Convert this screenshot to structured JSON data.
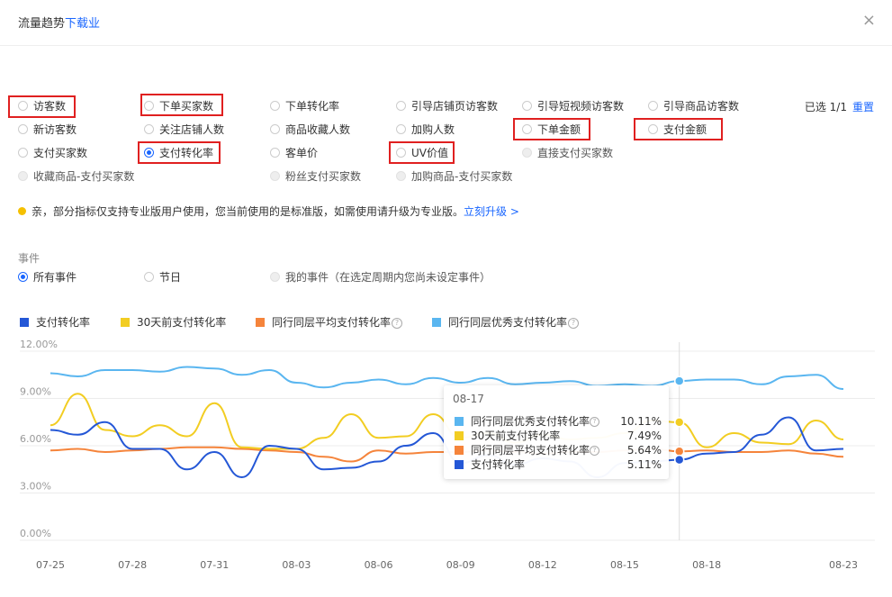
{
  "header": {
    "title": "流量趋势",
    "title_link": "下载业",
    "close_icon": "×"
  },
  "metrics": [
    {
      "label": "访客数",
      "state": "normal"
    },
    {
      "label": "下单买家数",
      "state": "normal"
    },
    {
      "label": "下单转化率",
      "state": "normal"
    },
    {
      "label": "引导店铺页访客数",
      "state": "normal"
    },
    {
      "label": "引导短视频访客数",
      "state": "normal"
    },
    {
      "label": "引导商品访客数",
      "state": "normal"
    },
    {
      "label": "新访客数",
      "state": "normal"
    },
    {
      "label": "关注店铺人数",
      "state": "normal"
    },
    {
      "label": "商品收藏人数",
      "state": "normal"
    },
    {
      "label": "加购人数",
      "state": "normal"
    },
    {
      "label": "下单金额",
      "state": "normal"
    },
    {
      "label": "支付金额",
      "state": "normal"
    },
    {
      "label": "支付买家数",
      "state": "normal"
    },
    {
      "label": "支付转化率",
      "state": "checked"
    },
    {
      "label": "客单价",
      "state": "normal"
    },
    {
      "label": "UV价值",
      "state": "normal"
    },
    {
      "label": "直接支付买家数",
      "state": "disabled"
    },
    {
      "label": "收藏商品-支付买家数",
      "state": "disabled"
    },
    {
      "label": "粉丝支付买家数",
      "state": "disabled"
    },
    {
      "label": "加购商品-支付买家数",
      "state": "disabled"
    }
  ],
  "selection": {
    "info": "已选 1/1",
    "reset": "重置"
  },
  "notice": {
    "text": "亲，部分指标仅支持专业版用户使用，您当前使用的是标准版，如需使用请升级为专业版。",
    "upgrade": "立刻升级 >"
  },
  "events": {
    "label": "事件",
    "options": [
      {
        "label": "所有事件",
        "state": "checked"
      },
      {
        "label": "节日",
        "state": "normal"
      },
      {
        "label": "我的事件（在选定周期内您尚未设定事件）",
        "state": "disabled"
      }
    ]
  },
  "help_icon": "?",
  "chart_data": {
    "type": "line",
    "colors": {
      "支付转化率": "#2457d6",
      "30天前支付转化率": "#f2cd22",
      "同行同层平均支付转化率": "#f5843b",
      "同行同层优秀支付转化率": "#5ab6f0"
    },
    "x": [
      "07-25",
      "07-26",
      "07-27",
      "07-28",
      "07-29",
      "07-30",
      "07-31",
      "08-01",
      "08-02",
      "08-03",
      "08-04",
      "08-05",
      "08-06",
      "08-07",
      "08-08",
      "08-09",
      "08-10",
      "08-11",
      "08-12",
      "08-13",
      "08-14",
      "08-15",
      "08-16",
      "08-17",
      "08-18",
      "08-19",
      "08-20",
      "08-21",
      "08-22",
      "08-23"
    ],
    "xticks": [
      "07-25",
      "07-28",
      "07-31",
      "08-03",
      "08-06",
      "08-09",
      "08-12",
      "08-15",
      "08-18",
      "08-23"
    ],
    "yticks": [
      "0.00%",
      "3.00%",
      "6.00%",
      "9.00%",
      "12.00%"
    ],
    "ylim": [
      0,
      12
    ],
    "series": [
      {
        "name": "支付转化率",
        "values": [
          7.0,
          6.7,
          7.5,
          5.8,
          5.8,
          4.5,
          5.6,
          4.0,
          6.0,
          5.8,
          4.5,
          4.6,
          5.0,
          6.0,
          6.8,
          4.9,
          5.4,
          4.8,
          5.2,
          5.0,
          4.0,
          4.9,
          5.0,
          5.11,
          5.5,
          5.6,
          6.7,
          7.8,
          5.7,
          5.8
        ]
      },
      {
        "name": "30天前支付转化率",
        "values": [
          7.3,
          9.3,
          7.0,
          6.6,
          7.3,
          6.6,
          8.7,
          5.9,
          5.8,
          5.8,
          6.5,
          8.0,
          6.5,
          6.6,
          8.0,
          6.5,
          6.8,
          6.2,
          6.7,
          6.4,
          6.5,
          6.8,
          7.6,
          7.49,
          5.9,
          6.8,
          6.2,
          6.1,
          7.6,
          6.4
        ]
      },
      {
        "name": "同行同层平均支付转化率",
        "values": [
          5.7,
          5.8,
          5.6,
          5.7,
          5.8,
          5.9,
          5.9,
          5.8,
          5.7,
          5.6,
          5.3,
          5.0,
          5.7,
          5.5,
          5.6,
          5.6,
          5.7,
          5.6,
          5.5,
          5.6,
          5.6,
          5.7,
          5.8,
          5.64,
          5.7,
          5.6,
          5.6,
          5.7,
          5.5,
          5.3
        ]
      },
      {
        "name": "同行同层优秀支付转化率",
        "values": [
          10.6,
          10.4,
          10.8,
          10.8,
          10.7,
          11.0,
          10.9,
          10.5,
          10.8,
          10.0,
          9.7,
          10.0,
          10.2,
          9.9,
          10.3,
          10.0,
          10.3,
          9.9,
          10.0,
          10.1,
          9.8,
          9.9,
          9.8,
          10.11,
          10.2,
          10.2,
          9.9,
          10.4,
          10.5,
          9.6
        ]
      }
    ],
    "tooltip": {
      "date": "08-17",
      "rows": [
        {
          "name": "同行同层优秀支付转化率",
          "value": "10.11%",
          "help": true,
          "color": "#5ab6f0"
        },
        {
          "name": "30天前支付转化率",
          "value": "7.49%",
          "help": false,
          "color": "#f2cd22"
        },
        {
          "name": "同行同层平均支付转化率",
          "value": "5.64%",
          "help": true,
          "color": "#f5843b"
        },
        {
          "name": "支付转化率",
          "value": "5.11%",
          "help": false,
          "color": "#2457d6"
        }
      ]
    }
  }
}
